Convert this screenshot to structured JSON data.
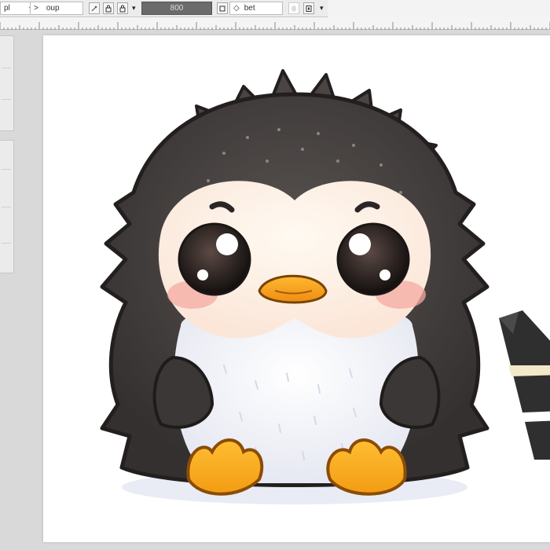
{
  "toolbar": {
    "field_1_value": "pl",
    "field_1_arrow": "▾",
    "field_2_caret": ">",
    "field_2_value": "oup",
    "tool_icon_1": "edit-icon",
    "tool_icon_2": "lock-icon",
    "size_value": "800",
    "stroke_value": "bet",
    "stroke_prefix": "◇",
    "fill_icon": "fill-icon",
    "layer_icon": "layer-icon"
  },
  "canvas": {
    "subject": "penguin-illustration",
    "colors": {
      "feather_dark": "#3e3a38",
      "feather_grey": "#5d5a59",
      "belly_white": "#ffffff",
      "face_cream": "#fdf2e6",
      "cheek_pink": "#f6a9a2",
      "beak_orange": "#f5a623",
      "feet_orange": "#f8a91f"
    }
  }
}
